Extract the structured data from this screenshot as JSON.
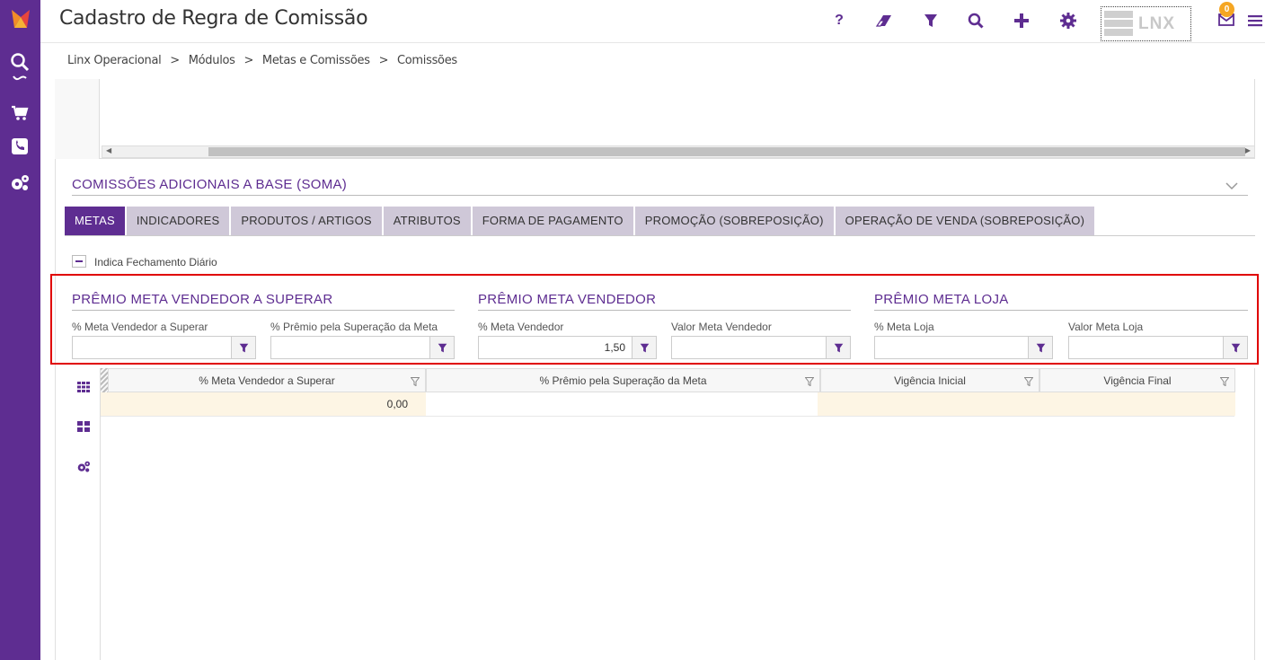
{
  "window": {
    "title": "Cadastro de Regra de Comissão"
  },
  "header": {
    "notification_count": "0",
    "logo_text": "LNX",
    "icons": [
      "help-icon",
      "eraser-icon",
      "filter-icon",
      "search-icon",
      "plus-icon",
      "gear-icon",
      "mail-icon",
      "menu-icon"
    ]
  },
  "breadcrumb": [
    "Linx Operacional",
    ">",
    "Módulos",
    ">",
    "Metas e Comissões",
    ">",
    "Comissões"
  ],
  "section": {
    "title": "COMISSÕES ADICIONAIS A BASE (SOMA)"
  },
  "tabs": [
    {
      "label": "METAS",
      "active": true
    },
    {
      "label": "INDICADORES"
    },
    {
      "label": "PRODUTOS / ARTIGOS"
    },
    {
      "label": "ATRIBUTOS"
    },
    {
      "label": "FORMA DE PAGAMENTO"
    },
    {
      "label": "PROMOÇÃO (SOBREPOSIÇÃO)"
    },
    {
      "label": "OPERAÇÃO DE VENDA (SOBREPOSIÇÃO)"
    }
  ],
  "checkbox": {
    "label": "Indica Fechamento Diário"
  },
  "groups": [
    {
      "title": "PRÊMIO META VENDEDOR A SUPERAR",
      "fields": [
        {
          "label": "% Meta Vendedor a Superar",
          "value": ""
        },
        {
          "label": "% Prêmio pela Superação da Meta",
          "value": ""
        }
      ]
    },
    {
      "title": "PRÊMIO META VENDEDOR",
      "fields": [
        {
          "label": "% Meta Vendedor",
          "value": "1,50"
        },
        {
          "label": "Valor Meta Vendedor",
          "value": ""
        }
      ]
    },
    {
      "title": "PRÊMIO META LOJA",
      "fields": [
        {
          "label": "% Meta Loja",
          "value": ""
        },
        {
          "label": "Valor Meta Loja",
          "value": ""
        }
      ]
    }
  ],
  "grid": {
    "columns": [
      "% Meta Vendedor a Superar",
      "% Prêmio pela Superação da Meta",
      "Vigência Inicial",
      "Vigência Final"
    ],
    "rows": [
      [
        "0,00",
        "",
        "",
        ""
      ]
    ]
  },
  "colors": {
    "accent": "#5e2d91",
    "highlight_row": "#fdf5e4",
    "selection_border": "#e00000"
  }
}
